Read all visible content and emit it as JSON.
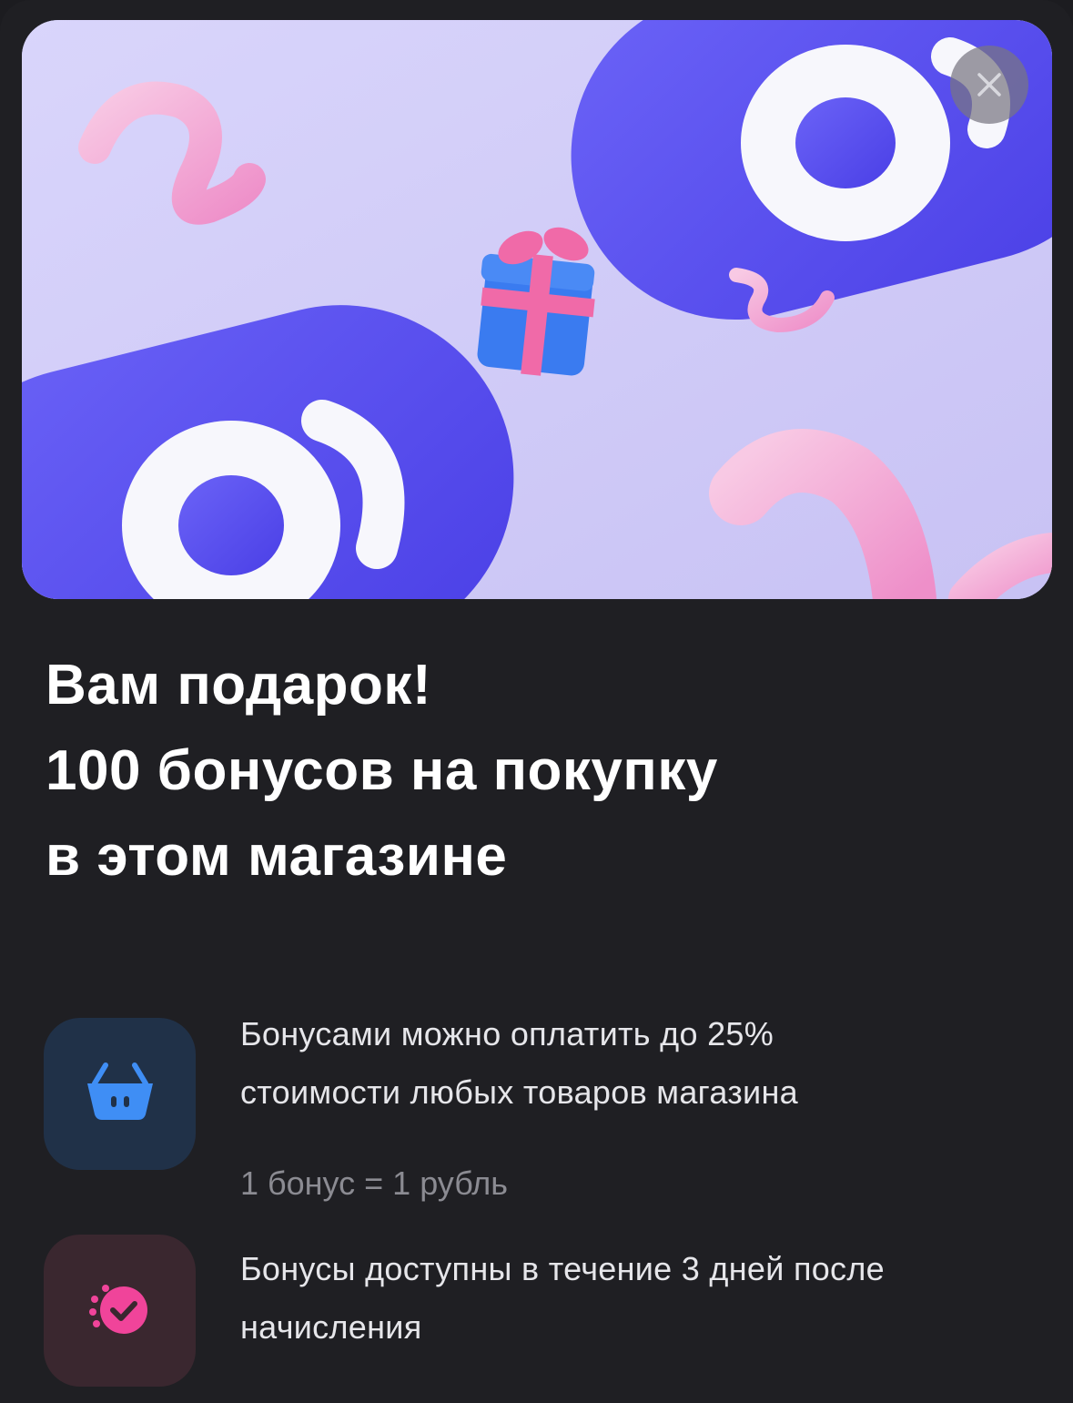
{
  "banner": {
    "image_name": "gift-bonus-illustration",
    "colors": {
      "background": "#cfcaf6",
      "shape_blue": "#5a4ff0",
      "ring_white": "#f6f6fb",
      "squiggle_pink": "#f2a6d6",
      "gift_blue": "#3a7bf0",
      "ribbon_pink": "#f06aa8"
    }
  },
  "close_button": {
    "icon": "close-icon"
  },
  "title": {
    "line1": "Вам подарок!",
    "line2": "100 бонусов на покупку",
    "line3": "в этом магазине"
  },
  "features": [
    {
      "icon": "basket-icon",
      "icon_bg": "#203148",
      "icon_color": "#3f8ef5",
      "line1": "Бонусами можно оплатить до 25%",
      "line2": "стоимости любых товаров магазина",
      "note": "1 бонус = 1 рубль"
    },
    {
      "icon": "timer-check-icon",
      "icon_bg": "#3a272f",
      "icon_color": "#f0449a",
      "line1": "Бонусы доступны в течение 3 дней после",
      "line2": "начисления"
    }
  ]
}
